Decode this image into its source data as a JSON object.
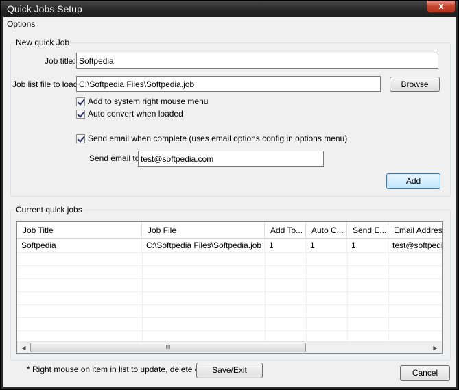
{
  "window": {
    "title": "Quick Jobs Setup",
    "close_label": "x"
  },
  "menu": {
    "items": [
      "Options"
    ]
  },
  "new_job": {
    "legend": "New quick Job",
    "job_title_label": "Job title:",
    "job_title_value": "Softpedia",
    "job_list_label": "Job list file to load:",
    "job_list_value": "C:\\Softpedia Files\\Softpedia.job",
    "browse_label": "Browse",
    "chk_add_menu": "Add to system right mouse menu",
    "chk_auto_convert": "Auto convert when loaded",
    "chk_send_email": "Send email when complete (uses email options config in options menu)",
    "send_email_label": "Send email to:",
    "send_email_value": "test@softpedia.com",
    "add_label": "Add"
  },
  "current_jobs": {
    "legend": "Current quick jobs",
    "columns": [
      "Job Title",
      "Job File",
      "Add To...",
      "Auto C...",
      "Send E...",
      "Email Address"
    ],
    "rows": [
      [
        "Softpedia",
        "C:\\Softpedia Files\\Softpedia.job",
        "1",
        "1",
        "1",
        "test@softpedia.com"
      ]
    ],
    "scroll_left": "◀",
    "scroll_right": "▶",
    "thumb_grip": "III"
  },
  "footer": {
    "hint": "* Right mouse on item in list to update, delete etc",
    "save_exit_label": "Save/Exit",
    "cancel_label": "Cancel"
  }
}
